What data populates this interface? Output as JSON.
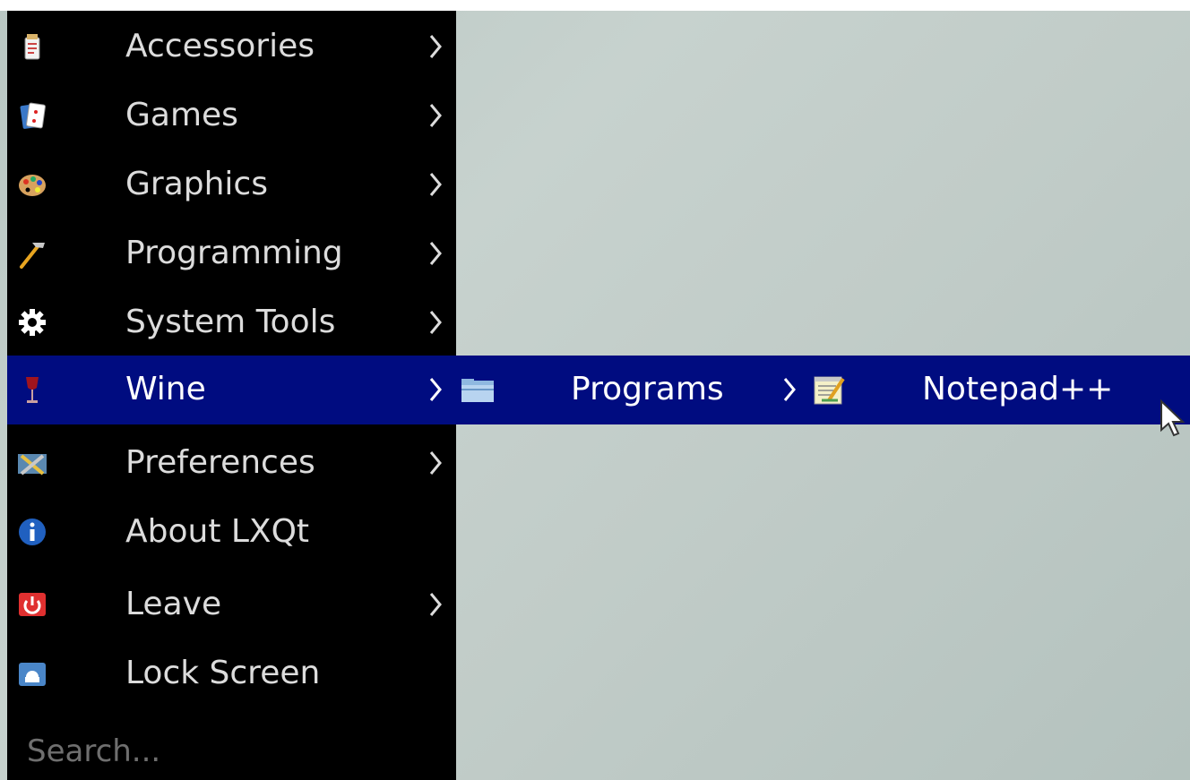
{
  "menu": {
    "items": [
      {
        "label": "Accessories",
        "icon": "accessories-icon",
        "has_submenu": true
      },
      {
        "label": "Games",
        "icon": "games-icon",
        "has_submenu": true
      },
      {
        "label": "Graphics",
        "icon": "graphics-icon",
        "has_submenu": true
      },
      {
        "label": "Programming",
        "icon": "programming-icon",
        "has_submenu": true
      },
      {
        "label": "System Tools",
        "icon": "system-tools-icon",
        "has_submenu": true
      },
      {
        "label": "Wine",
        "icon": "wine-icon",
        "has_submenu": true,
        "active": true
      },
      {
        "label": "Preferences",
        "icon": "preferences-icon",
        "has_submenu": true
      },
      {
        "label": "About LXQt",
        "icon": "info-icon",
        "has_submenu": false
      },
      {
        "label": "Leave",
        "icon": "power-icon",
        "has_submenu": true
      },
      {
        "label": "Lock Screen",
        "icon": "lock-screen-icon",
        "has_submenu": false
      }
    ],
    "search_placeholder": "Search..."
  },
  "wine_submenu": {
    "items": [
      {
        "label": "Programs",
        "icon": "folder-icon",
        "has_submenu": true
      }
    ]
  },
  "programs_submenu": {
    "items": [
      {
        "label": "Notepad++",
        "icon": "notepad-icon",
        "has_submenu": false
      }
    ]
  },
  "colors": {
    "menu_background": "#000000",
    "highlight": "#000c80",
    "text": "#dcdcdc",
    "desktop": "#c1ccc8"
  }
}
